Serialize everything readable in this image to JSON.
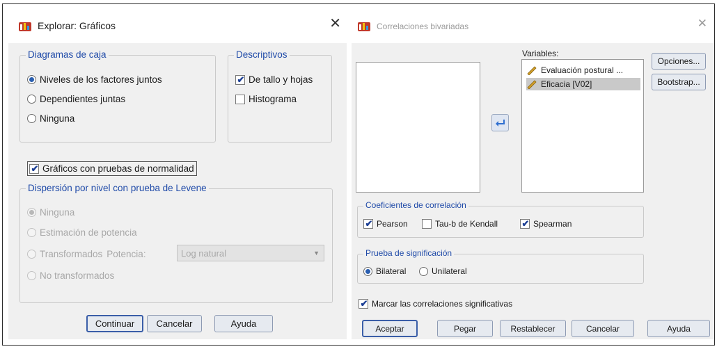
{
  "explore_dialog": {
    "title": "Explorar: Gráficos",
    "close_glyph": "✕",
    "boxplots": {
      "legend": "Diagramas de caja",
      "options": [
        "Niveles de los factores juntos",
        "Dependientes juntas",
        "Ninguna"
      ],
      "selected_index": 0
    },
    "descriptives": {
      "legend": "Descriptivos",
      "stem_leaf": "De tallo y hojas",
      "stem_leaf_checked": true,
      "histogram": "Histograma",
      "histogram_checked": false
    },
    "normality_plots": "Gráficos con pruebas de normalidad",
    "normality_checked": true,
    "levene": {
      "legend": "Dispersión por nivel con prueba de Levene",
      "none": "Ninguna",
      "power_estimation": "Estimación de potencia",
      "transformed": "Transformados",
      "power_label": "Potencia:",
      "power_value": "Log natural",
      "untransformed": "No transformados"
    },
    "buttons": {
      "continue": "Continuar",
      "cancel": "Cancelar",
      "help": "Ayuda"
    }
  },
  "bivariate_dialog": {
    "title": "Correlaciones bivariadas",
    "close_glyph": "✕",
    "variables_label": "Variables:",
    "variables": [
      "Evaluación postural ...",
      "Eficacia [V02]"
    ],
    "side_buttons": {
      "options": "Opciones...",
      "bootstrap": "Bootstrap..."
    },
    "coefficients": {
      "legend": "Coeficientes de correlación",
      "pearson": "Pearson",
      "pearson_checked": true,
      "kendall": "Tau-b de Kendall",
      "kendall_checked": false,
      "spearman": "Spearman",
      "spearman_checked": true
    },
    "significance": {
      "legend": "Prueba de significación",
      "two_tailed": "Bilateral",
      "one_tailed": "Unilateral",
      "selected": "Bilateral"
    },
    "flag_significant": "Marcar las correlaciones significativas",
    "flag_checked": true,
    "buttons": {
      "ok": "Aceptar",
      "paste": "Pegar",
      "reset": "Restablecer",
      "cancel": "Cancelar",
      "help": "Ayuda"
    }
  }
}
